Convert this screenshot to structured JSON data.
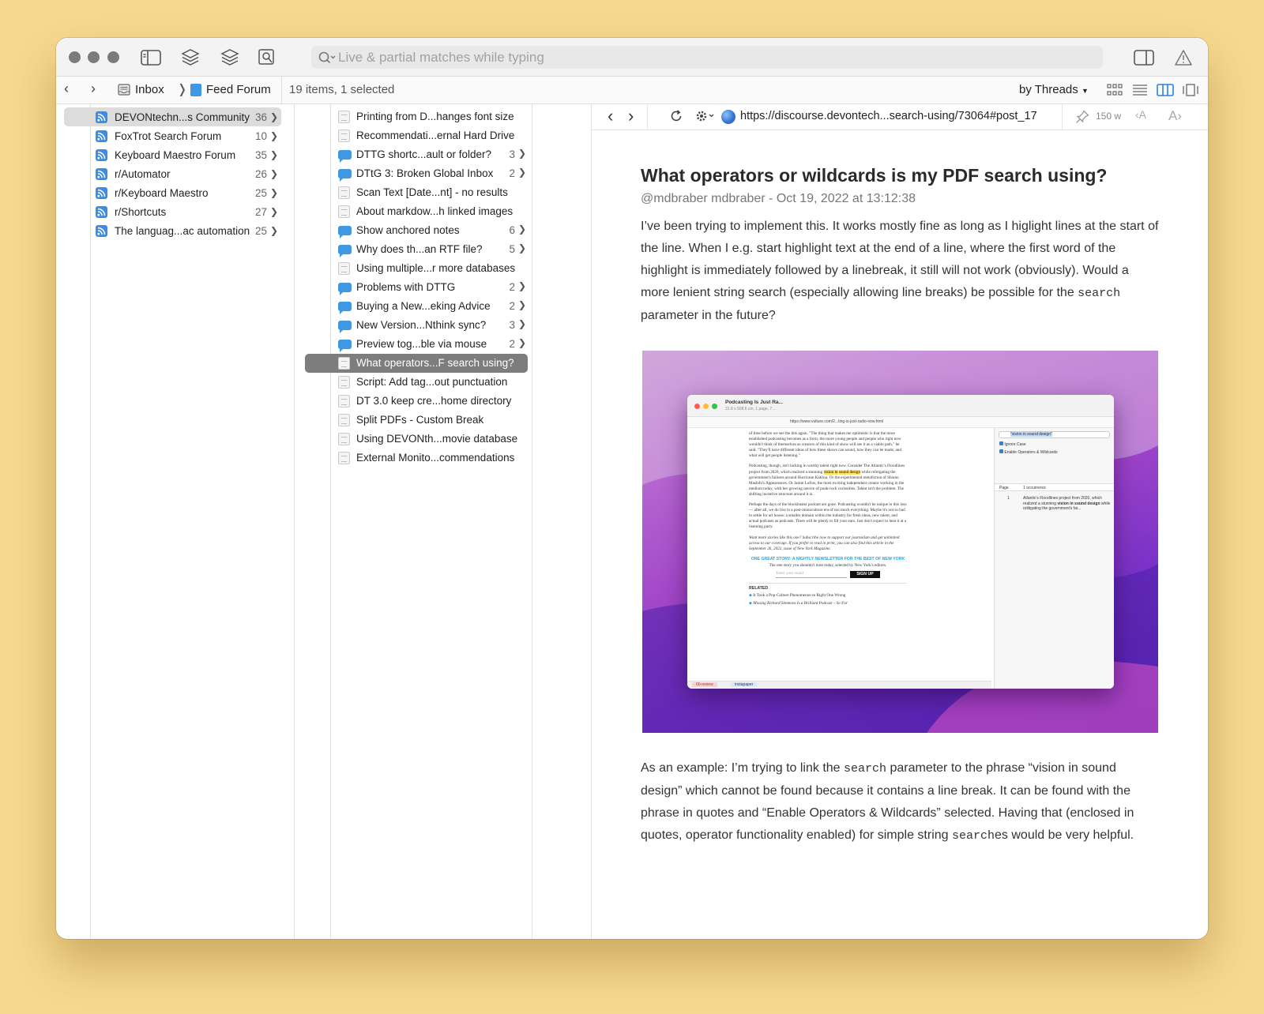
{
  "toolbar": {
    "search_placeholder": "Live & partial matches while typing"
  },
  "pathbar": {
    "crumbs": [
      "Inbox",
      "Feed Forum"
    ],
    "status": "19 items, 1 selected",
    "sort": "by Threads"
  },
  "feeds": [
    {
      "name": "DEVONtechn...s Community",
      "count": "36",
      "selected": true
    },
    {
      "name": "FoxTrot Search Forum",
      "count": "10"
    },
    {
      "name": "Keyboard Maestro Forum",
      "count": "35"
    },
    {
      "name": "r/Automator",
      "count": "26"
    },
    {
      "name": "r/Keyboard Maestro",
      "count": "25"
    },
    {
      "name": "r/Shortcuts",
      "count": "27"
    },
    {
      "name": "The languag...ac automation",
      "count": "25"
    }
  ],
  "items": [
    {
      "name": "Printing from D...hanges font size",
      "icon": "doc",
      "count": ""
    },
    {
      "name": "Recommendati...ernal Hard Drive",
      "icon": "doc",
      "count": ""
    },
    {
      "name": "DTTG shortc...ault or folder?",
      "icon": "bubble",
      "count": "3"
    },
    {
      "name": "DTtG 3: Broken Global Inbox",
      "icon": "bubble",
      "count": "2"
    },
    {
      "name": "Scan Text [Date...nt] - no results",
      "icon": "doc",
      "count": ""
    },
    {
      "name": "About markdow...h linked images",
      "icon": "doc",
      "count": ""
    },
    {
      "name": "Show anchored notes",
      "icon": "bubble",
      "count": "6"
    },
    {
      "name": "Why does th...an RTF file?",
      "icon": "bubble",
      "count": "5"
    },
    {
      "name": "Using multiple...r more databases",
      "icon": "doc",
      "count": ""
    },
    {
      "name": "Problems with DTTG",
      "icon": "bubble",
      "count": "2"
    },
    {
      "name": "Buying a New...eking Advice",
      "icon": "bubble",
      "count": "2"
    },
    {
      "name": "New Version...Nthink sync?",
      "icon": "bubble",
      "count": "3"
    },
    {
      "name": "Preview tog...ble via mouse",
      "icon": "bubble",
      "count": "2"
    },
    {
      "name": "What operators...F search using?",
      "icon": "doc",
      "count": "",
      "selected": true
    },
    {
      "name": "Script: Add tag...out punctuation",
      "icon": "doc",
      "count": ""
    },
    {
      "name": "DT 3.0 keep cre...home directory",
      "icon": "doc",
      "count": ""
    },
    {
      "name": "Split PDFs - Custom Break",
      "icon": "doc",
      "count": ""
    },
    {
      "name": "Using DEVONth...movie database",
      "icon": "doc",
      "count": ""
    },
    {
      "name": "External Monito...commendations",
      "icon": "doc",
      "count": ""
    }
  ],
  "viewer": {
    "url": "https://discourse.devontech...search-using/73064#post_17",
    "word_count": "150 w"
  },
  "article": {
    "title": "What operators or wildcards is my PDF search using?",
    "meta": "@mdbraber mdbraber - Oct 19, 2022 at 13:12:38",
    "para1_a": "I’ve been trying to implement this. It works mostly fine as long as I higlight lines at the start of the line. When I e.g. start highlight text at the end of a line, where the first word of the highlight is immediately followed by a linebreak, it still will not work (obviously). Would a more lenient string search (especially allowing line breaks) be possible for the ",
    "para1_code": "search",
    "para1_b": " parameter in the future?",
    "para2_a": "As an example: I’m trying to link the ",
    "para2_code1": "search",
    "para2_b": " parameter to the phrase “vision in sound design” which cannot be found because it contains a line break. It can be found with the phrase in quotes and “Enable Operators & Wildcards” selected. Having that (enclosed in quotes, operator functionality enabled) for simple string ",
    "para2_code2": "search",
    "para2_c": "es would be very helpful."
  },
  "embedded_screenshot": {
    "title": "Podcasting Is Just Ra...",
    "subtitle": "31.8 x 508.6 cm, 1 page, 7...",
    "url": "https://www.vulture.com/2...ting-is-just-radio-now.html",
    "search_query": "\"vision in sound design\"",
    "opt_ignore_case": "Ignore Case",
    "opt_enable_ops": "Enable Operators & Wildcards",
    "col_page": "Page",
    "col_occurrence": "1 occurrence",
    "result_page": "1",
    "result_text_a": "Atlantic's Floodlines project from 2020, which realized a stunning ",
    "result_highlight": "vision in sound design",
    "result_text_b": " while relitigating the government's fai...",
    "p1": "of time before we see the hits again. \"The thing that makes me optimistic is that the more established podcasting becomes as a form, the more young people and people who right now wouldn't think of themselves as creators of this kind of show will see it as a viable path,\" he said. \"They'll have different ideas of how these shows can sound, how they can be made, and what will get people listening.\"",
    "p2_a": "Podcasting, though, isn't lacking in worthy talent right now. Consider The Atlantic's Floodlines project from 2020, which realized a stunning ",
    "p2_hl1": "vision in",
    "p2_hl2": "sound design",
    "p2_b": " while relitigating the government's failures around Hurricane Katrina. Or the experimental metafiction of Sharon Mashihi's Appearances. Or Jamie Loftus, the most exciting independent creator working in the medium today, with her growing oeuvre of punk-rock curiosities. Talent isn't the problem. The shifting incentive structure around it is.",
    "p3": "Perhaps the days of the blockbuster podcast are gone. Podcasting wouldn't be unique in this loss — after all, we do live in a post-monoculture era of too much everything. Maybe it's not so bad to settle for art house: a smaller domain within the industry for fresh ideas, new talent, and actual podcasts as podcasts. There will be plenty to fill your ears. Just don't expect to hear it at a listening party.",
    "p4": "Want more stories like this one? Subscribe now to support our journalism and get unlimited access to our coverage. If you prefer to read in print, you can also find this article in the September 26, 2022, issue of New York Magazine.",
    "newsletter": "ONE GREAT STORY: A NIGHTLY NEWSLETTER FOR THE BEST OF NEW YORK",
    "newsletter_sub": "The one story you shouldn't miss today, selected by New York's editors.",
    "email_placeholder": "Enter your email",
    "signup": "SIGN UP",
    "related": "RELATED",
    "related1": "It Took a Pop-Culture Phenomenon to Right One Wrong",
    "related2": "Missing Richard Simmons Is a Brilliant Podcast – So Far",
    "tag1": "00-review",
    "tag2": "instapaper"
  }
}
